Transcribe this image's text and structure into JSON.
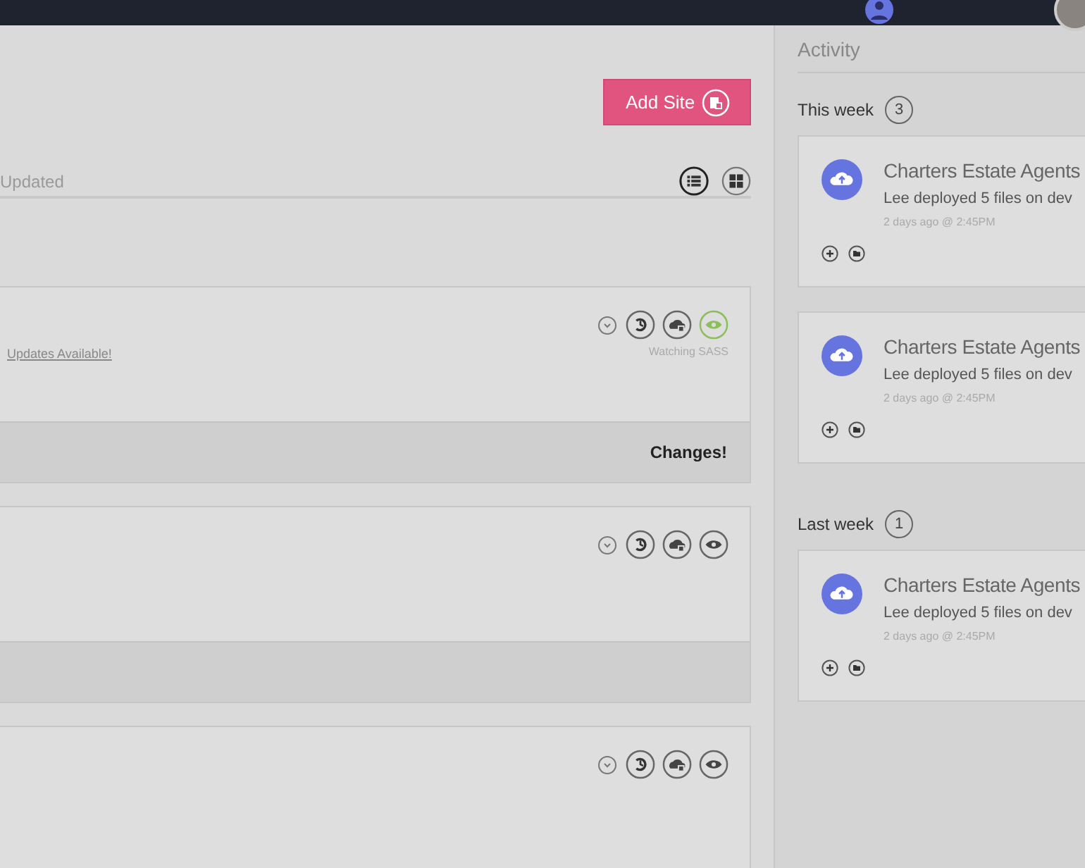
{
  "toolbar": {
    "add_button": "Add Site",
    "sort_label": "Updated",
    "views": [
      {
        "kind": "list",
        "selected": true
      },
      {
        "kind": "grid",
        "selected": false
      }
    ]
  },
  "sites": [
    {
      "updates_link": "Updates Available!",
      "watching": true,
      "watch_label": "Watching SASS",
      "footer": "Changes!"
    },
    {
      "watching": false,
      "footer_shown": true
    },
    {
      "watching": false
    }
  ],
  "activity": {
    "title": "Activity",
    "groups": [
      {
        "label": "This week",
        "count": "3",
        "items": [
          {
            "site": "Charters Estate Agents",
            "message": "Lee deployed 5 files on dev",
            "time": "2 days ago @ 2:45PM"
          },
          {
            "site": "Charters Estate Agents",
            "message": "Lee deployed 5 files on dev",
            "time": "2 days ago @ 2:45PM"
          }
        ]
      },
      {
        "label": "Last week",
        "count": "1",
        "items": [
          {
            "site": "Charters Estate Agents",
            "message": "Lee deployed 5 files on dev",
            "time": "2 days ago @ 2:45PM"
          }
        ]
      }
    ]
  }
}
